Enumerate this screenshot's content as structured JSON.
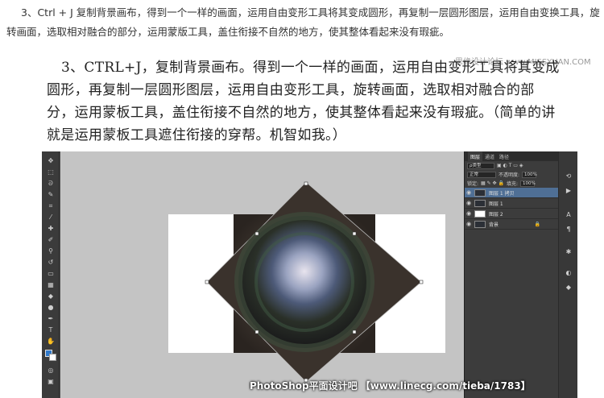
{
  "intro": "3、Ctrl + J 复制背景画布，得到一个一样的画面，运用自由变形工具将其变成圆形，再复制一层圆形图层，运用自由变换工具，旋转画面，选取相对融合的部分，运用蒙版工具，盖住衔接不自然的地方，使其整体看起来没有瑕疵。",
  "caption": "3、CTRL+J，复制背景画布。得到一个一样的画面，运用自由变形工具将其变成圆形，再复制一层圆形图层，运用自由变形工具，旋转画面，选取相对融合的部分，运用蒙板工具，盖住衔接不自然的地方，使其整体看起来没有瑕疵。（简单的讲就是运用蒙板工具遮住衔接的穿帮。机智如我。）",
  "watermark_top": "思缘设计论坛 www.MISSYUAN.COM",
  "photoshop": {
    "panel_tabs": [
      "图层",
      "通道",
      "路径"
    ],
    "kind_label": "ρ类型",
    "blend_mode": "正常",
    "opacity_label": "不透明度:",
    "opacity_value": "100%",
    "lock_label": "锁定:",
    "fill_label": "填充:",
    "fill_value": "100%",
    "layers": [
      {
        "name": "图层 1 拷贝",
        "selected": true
      },
      {
        "name": "图层 1",
        "selected": false
      },
      {
        "name": "图层 2",
        "selected": false
      },
      {
        "name": "背景",
        "selected": false
      }
    ],
    "colors": {
      "foreground": "#2f78c9",
      "background": "#ffffff",
      "selection": "#4f6f95"
    }
  },
  "footer_watermark": "PhotoShop平面设计吧 【www.linecg.com/tieba/1783】"
}
